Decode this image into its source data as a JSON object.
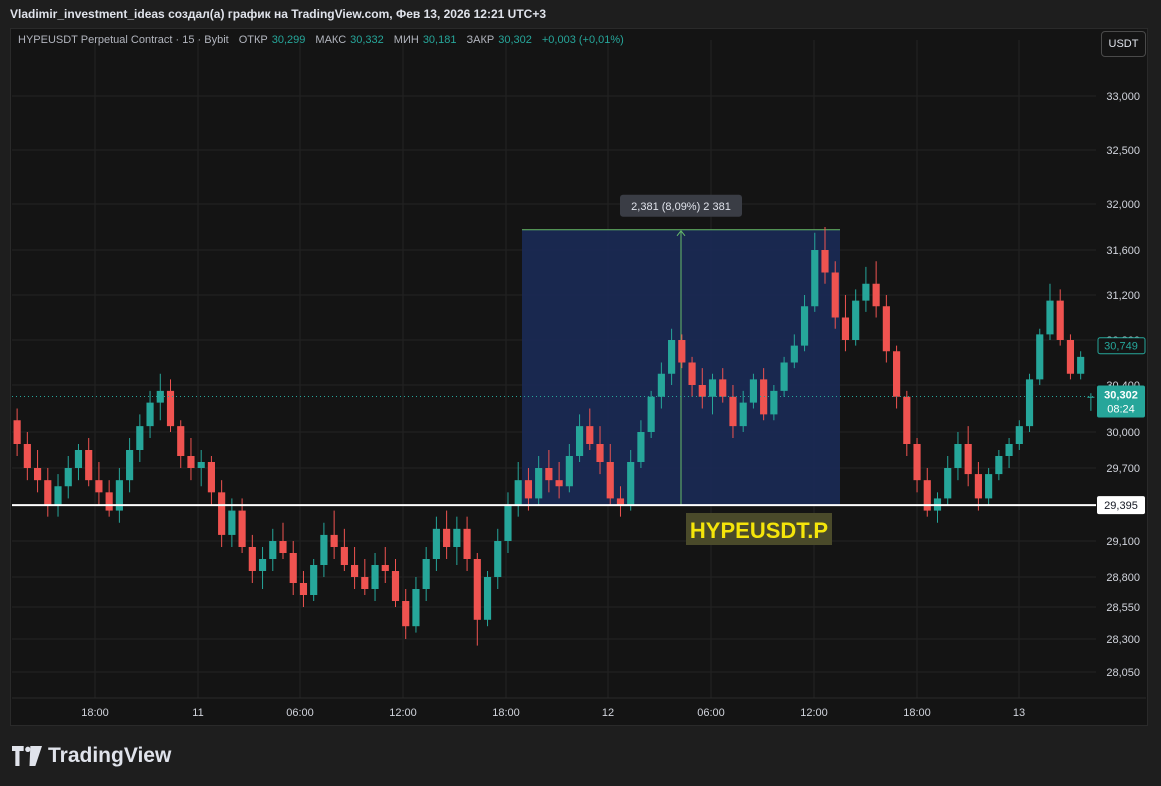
{
  "header": {
    "title": "Vladimir_investment_ideas создал(а) график на TradingView.com, Фев 13, 2026 12:21 UTC+3"
  },
  "legend": {
    "symbol": "HYPEUSDT Perpetual Contract · 15 · Bybit",
    "open_label": "ОТКР",
    "open": "30,299",
    "high_label": "МАКС",
    "high": "30,332",
    "low_label": "МИН",
    "low": "30,181",
    "close_label": "ЗАКР",
    "close": "30,302",
    "change": "+0,003 (+0,01%)"
  },
  "currency_button": "USDT",
  "footer": {
    "brand": "TradingView"
  },
  "colors": {
    "up": "#26a69a",
    "down": "#ef5350",
    "range_box": "#1a2a55",
    "range_border": "#66bb6a",
    "label_bg": "#4a4a2a",
    "label_text": "#f5e50a"
  },
  "chart_data": {
    "type": "candlestick",
    "symbol_label": "HYPEUSDT.P",
    "y_axis": {
      "ticks": [
        "33,000",
        "32,500",
        "32,000",
        "31,600",
        "31,200",
        "30,800",
        "30,400",
        "30,000",
        "29,700",
        "29,100",
        "28,800",
        "28,550",
        "28,300",
        "28,050"
      ],
      "tick_values": [
        33.0,
        32.5,
        32.0,
        31.6,
        31.2,
        30.8,
        30.4,
        30.0,
        29.7,
        29.1,
        28.8,
        28.55,
        28.3,
        28.05
      ]
    },
    "x_axis": {
      "ticks": [
        "18:00",
        "11",
        "06:00",
        "12:00",
        "18:00",
        "12",
        "06:00",
        "12:00",
        "18:00",
        "13"
      ]
    },
    "horizontal_line": {
      "value": 29.395,
      "label": "29,395"
    },
    "last_price": {
      "value": 30.302,
      "label": "30,302",
      "countdown": "08:24"
    },
    "alert_price": {
      "value": 30.749,
      "label": "30,749"
    },
    "measure": {
      "label": "2,381 (8,09%) 2 381",
      "from": 29.395,
      "to": 31.776
    },
    "candles": [
      [
        30.1,
        30.2,
        29.8,
        29.9
      ],
      [
        29.9,
        30.0,
        29.6,
        29.7
      ],
      [
        29.7,
        29.85,
        29.5,
        29.6
      ],
      [
        29.6,
        29.7,
        29.3,
        29.4
      ],
      [
        29.4,
        29.65,
        29.3,
        29.55
      ],
      [
        29.55,
        29.8,
        29.45,
        29.7
      ],
      [
        29.7,
        29.9,
        29.6,
        29.85
      ],
      [
        29.85,
        29.95,
        29.55,
        29.6
      ],
      [
        29.6,
        29.75,
        29.4,
        29.5
      ],
      [
        29.5,
        29.6,
        29.3,
        29.35
      ],
      [
        29.35,
        29.7,
        29.25,
        29.6
      ],
      [
        29.6,
        29.95,
        29.5,
        29.85
      ],
      [
        29.85,
        30.15,
        29.75,
        30.05
      ],
      [
        30.05,
        30.35,
        29.95,
        30.25
      ],
      [
        30.25,
        30.5,
        30.1,
        30.35
      ],
      [
        30.35,
        30.45,
        30.0,
        30.05
      ],
      [
        30.05,
        30.1,
        29.7,
        29.8
      ],
      [
        29.8,
        29.95,
        29.6,
        29.7
      ],
      [
        29.7,
        29.85,
        29.55,
        29.75
      ],
      [
        29.75,
        29.8,
        29.4,
        29.5
      ],
      [
        29.5,
        29.6,
        29.05,
        29.15
      ],
      [
        29.15,
        29.45,
        29.05,
        29.35
      ],
      [
        29.35,
        29.45,
        29.0,
        29.05
      ],
      [
        29.05,
        29.15,
        28.75,
        28.85
      ],
      [
        28.85,
        29.05,
        28.7,
        28.95
      ],
      [
        28.95,
        29.2,
        28.85,
        29.1
      ],
      [
        29.1,
        29.25,
        28.95,
        29.0
      ],
      [
        29.0,
        29.1,
        28.65,
        28.75
      ],
      [
        28.75,
        28.85,
        28.55,
        28.65
      ],
      [
        28.65,
        28.95,
        28.6,
        28.9
      ],
      [
        28.9,
        29.25,
        28.8,
        29.15
      ],
      [
        29.15,
        29.35,
        28.95,
        29.05
      ],
      [
        29.05,
        29.2,
        28.85,
        28.9
      ],
      [
        28.9,
        29.05,
        28.7,
        28.8
      ],
      [
        28.8,
        28.95,
        28.65,
        28.7
      ],
      [
        28.7,
        29.0,
        28.6,
        28.9
      ],
      [
        28.9,
        29.05,
        28.75,
        28.85
      ],
      [
        28.85,
        28.95,
        28.55,
        28.6
      ],
      [
        28.6,
        28.7,
        28.3,
        28.4
      ],
      [
        28.4,
        28.8,
        28.35,
        28.7
      ],
      [
        28.7,
        29.05,
        28.6,
        28.95
      ],
      [
        28.95,
        29.3,
        28.85,
        29.2
      ],
      [
        29.2,
        29.35,
        28.95,
        29.05
      ],
      [
        29.05,
        29.3,
        28.9,
        29.2
      ],
      [
        29.2,
        29.3,
        28.85,
        28.95
      ],
      [
        28.95,
        29.0,
        28.25,
        28.45
      ],
      [
        28.45,
        28.85,
        28.4,
        28.8
      ],
      [
        28.8,
        29.2,
        28.7,
        29.1
      ],
      [
        29.1,
        29.5,
        29.0,
        29.4
      ],
      [
        29.4,
        29.75,
        29.3,
        29.6
      ],
      [
        29.6,
        29.7,
        29.35,
        29.45
      ],
      [
        29.45,
        29.8,
        29.4,
        29.7
      ],
      [
        29.7,
        29.85,
        29.5,
        29.6
      ],
      [
        29.6,
        29.75,
        29.45,
        29.55
      ],
      [
        29.55,
        29.9,
        29.5,
        29.8
      ],
      [
        29.8,
        30.15,
        29.75,
        30.05
      ],
      [
        30.05,
        30.2,
        29.85,
        29.9
      ],
      [
        29.9,
        30.05,
        29.65,
        29.75
      ],
      [
        29.75,
        29.9,
        29.4,
        29.45
      ],
      [
        29.45,
        29.55,
        29.3,
        29.4
      ],
      [
        29.4,
        29.85,
        29.35,
        29.75
      ],
      [
        29.75,
        30.1,
        29.7,
        30.0
      ],
      [
        30.0,
        30.35,
        29.95,
        30.3
      ],
      [
        30.3,
        30.6,
        30.2,
        30.5
      ],
      [
        30.5,
        30.9,
        30.4,
        30.8
      ],
      [
        30.8,
        30.85,
        30.55,
        30.6
      ],
      [
        30.6,
        30.65,
        30.3,
        30.4
      ],
      [
        30.4,
        30.55,
        30.2,
        30.3
      ],
      [
        30.3,
        30.5,
        30.15,
        30.45
      ],
      [
        30.45,
        30.55,
        30.25,
        30.3
      ],
      [
        30.3,
        30.4,
        29.95,
        30.05
      ],
      [
        30.05,
        30.35,
        30.0,
        30.25
      ],
      [
        30.25,
        30.5,
        30.2,
        30.45
      ],
      [
        30.45,
        30.55,
        30.1,
        30.15
      ],
      [
        30.15,
        30.4,
        30.1,
        30.35
      ],
      [
        30.35,
        30.65,
        30.3,
        30.6
      ],
      [
        30.6,
        30.85,
        30.55,
        30.75
      ],
      [
        30.75,
        31.2,
        30.7,
        31.1
      ],
      [
        31.1,
        31.75,
        31.05,
        31.6
      ],
      [
        31.6,
        31.8,
        31.3,
        31.4
      ],
      [
        31.4,
        31.5,
        30.9,
        31.0
      ],
      [
        31.0,
        31.2,
        30.7,
        30.8
      ],
      [
        30.8,
        31.25,
        30.75,
        31.15
      ],
      [
        31.15,
        31.45,
        31.05,
        31.3
      ],
      [
        31.3,
        31.5,
        31.0,
        31.1
      ],
      [
        31.1,
        31.2,
        30.6,
        30.7
      ],
      [
        30.7,
        30.75,
        30.2,
        30.3
      ],
      [
        30.3,
        30.35,
        29.8,
        29.9
      ],
      [
        29.9,
        29.95,
        29.5,
        29.6
      ],
      [
        29.6,
        29.7,
        29.3,
        29.35
      ],
      [
        29.35,
        29.5,
        29.25,
        29.45
      ],
      [
        29.45,
        29.8,
        29.4,
        29.7
      ],
      [
        29.7,
        30.0,
        29.6,
        29.9
      ],
      [
        29.9,
        30.05,
        29.55,
        29.65
      ],
      [
        29.65,
        29.75,
        29.35,
        29.45
      ],
      [
        29.45,
        29.7,
        29.4,
        29.65
      ],
      [
        29.65,
        29.85,
        29.6,
        29.8
      ],
      [
        29.8,
        29.95,
        29.7,
        29.9
      ],
      [
        29.9,
        30.1,
        29.85,
        30.05
      ],
      [
        30.05,
        30.5,
        30.0,
        30.45
      ],
      [
        30.45,
        30.9,
        30.4,
        30.85
      ],
      [
        30.85,
        31.3,
        30.8,
        31.15
      ],
      [
        31.15,
        31.25,
        30.75,
        30.8
      ],
      [
        30.8,
        30.85,
        30.45,
        30.5
      ],
      [
        30.5,
        30.7,
        30.45,
        30.65
      ],
      [
        30.3,
        30.33,
        30.18,
        30.3
      ]
    ]
  }
}
